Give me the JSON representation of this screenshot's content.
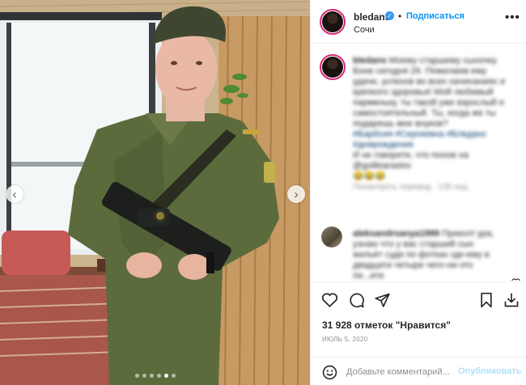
{
  "header": {
    "username": "bledans",
    "verified_mark": "✓",
    "separator": "•",
    "follow_label": "Подписаться",
    "location": "Сочи",
    "more_label": "•••"
  },
  "caption": {
    "username": "bledans",
    "text": "Моему старшему сыночку Боне сегодня 26. Пожелаем ему удачи, успехов во всех начинаниях и крепкого здоровья! Мой любимый парменьку, ты такой уже взрослый и самостоятельный. Ты, когда же ты подарешь мне внуков?",
    "tags": "#Барбсия #Сергеевна #Бледанс #днирождения",
    "tail": "И не говорите, что похож на @goliktaraslov",
    "emojis": "😂😂😂",
    "meta": "Посмотреть перевод · 135 нед."
  },
  "comment": {
    "username": "aleksandrsanya1999",
    "text": "Прикол! ура, узнаю что у вас старший сын жильёт судя по фотках где-ему в двадцати четыре чего-ни-это",
    "tail": "пи...ите"
  },
  "media": {
    "prev_label": "‹",
    "next_label": "›",
    "slides": 6,
    "active_slide": 5
  },
  "actions": {
    "like_icon": "heart-icon",
    "comment_icon": "comment-icon",
    "share_icon": "paper-plane-icon",
    "save_icon": "bookmark-icon",
    "likes_text": "31 928 отметок \"Нравится\"",
    "date": "июль 5, 2020"
  },
  "comment_bar": {
    "placeholder": "Добавьте комментарий...",
    "post_label": "Опубликовать"
  },
  "colors": {
    "accent": "#0095f6",
    "story_ring": "#d62976",
    "post_disabled": "#b2dffc"
  }
}
